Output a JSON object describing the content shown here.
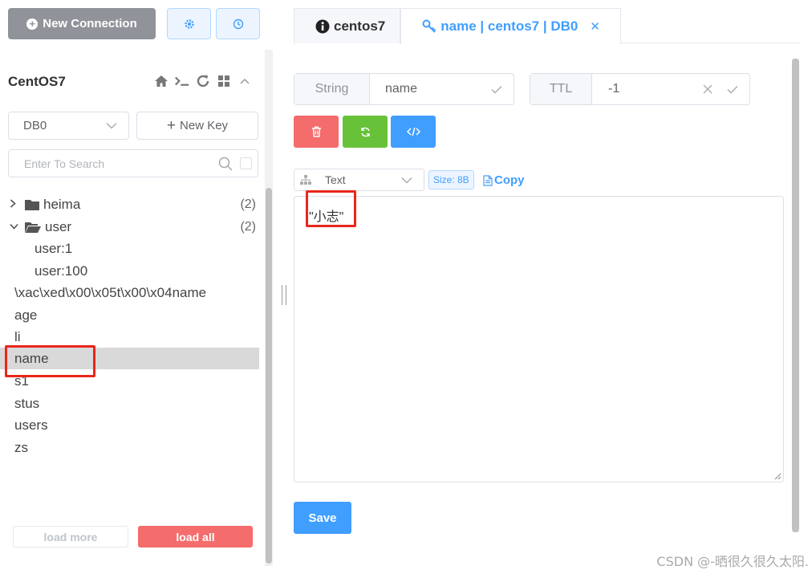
{
  "sidebar": {
    "new_connection_label": "New Connection",
    "connection_name": "CentOS7",
    "db_select": "DB0",
    "new_key_label": "New Key",
    "search_placeholder": "Enter To Search",
    "tree": [
      {
        "label": "heima",
        "count": "(2)",
        "kind": "folder",
        "expanded": false
      },
      {
        "label": "user",
        "count": "(2)",
        "kind": "folder",
        "expanded": true
      },
      {
        "label": "user:1",
        "kind": "child"
      },
      {
        "label": "user:100",
        "kind": "child"
      },
      {
        "label": "\\xac\\xed\\x00\\x05t\\x00\\x04name",
        "kind": "key"
      },
      {
        "label": "age",
        "kind": "key"
      },
      {
        "label": "li",
        "kind": "key"
      },
      {
        "label": "name",
        "kind": "key",
        "selected": true
      },
      {
        "label": "s1",
        "kind": "key"
      },
      {
        "label": "stus",
        "kind": "key"
      },
      {
        "label": "users",
        "kind": "key"
      },
      {
        "label": "zs",
        "kind": "key"
      }
    ],
    "load_more_label": "load more",
    "load_all_label": "load all"
  },
  "main": {
    "tabs": [
      {
        "label": "centos7",
        "icon": "info-icon"
      },
      {
        "label": "name | centos7 | DB0",
        "icon": "key-icon",
        "active": true
      }
    ],
    "key_type": "String",
    "key_name": "name",
    "ttl_label": "TTL",
    "ttl_value": "-1",
    "format": "Text",
    "size_tag": "Size: 8B",
    "copy_label": "Copy",
    "value": "\"小志\"",
    "save_label": "Save"
  },
  "watermark": "CSDN @-晒很久很久太阳.",
  "colors": {
    "primary": "#409eff",
    "danger": "#f56c6c",
    "success": "#67c23a",
    "gray_button": "#909399",
    "highlight_box": "#e8261c",
    "selected_row": "#d9d9d9"
  }
}
